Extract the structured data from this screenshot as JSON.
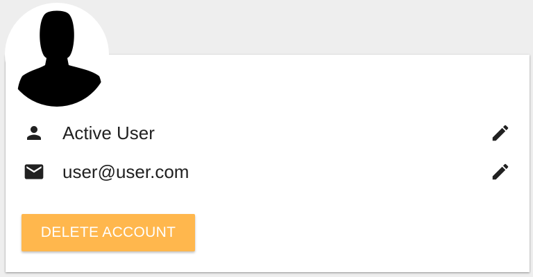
{
  "user": {
    "name": "Active User",
    "email": "user@user.com"
  },
  "actions": {
    "delete_label": "DELETE ACCOUNT"
  },
  "icons": {
    "avatar": "person-silhouette-icon",
    "name": "person-icon",
    "email": "mail-icon",
    "edit": "pencil-icon"
  },
  "colors": {
    "background": "#eeeeee",
    "card": "#ffffff",
    "delete_button": "#ffb74d",
    "text": "#212121"
  }
}
